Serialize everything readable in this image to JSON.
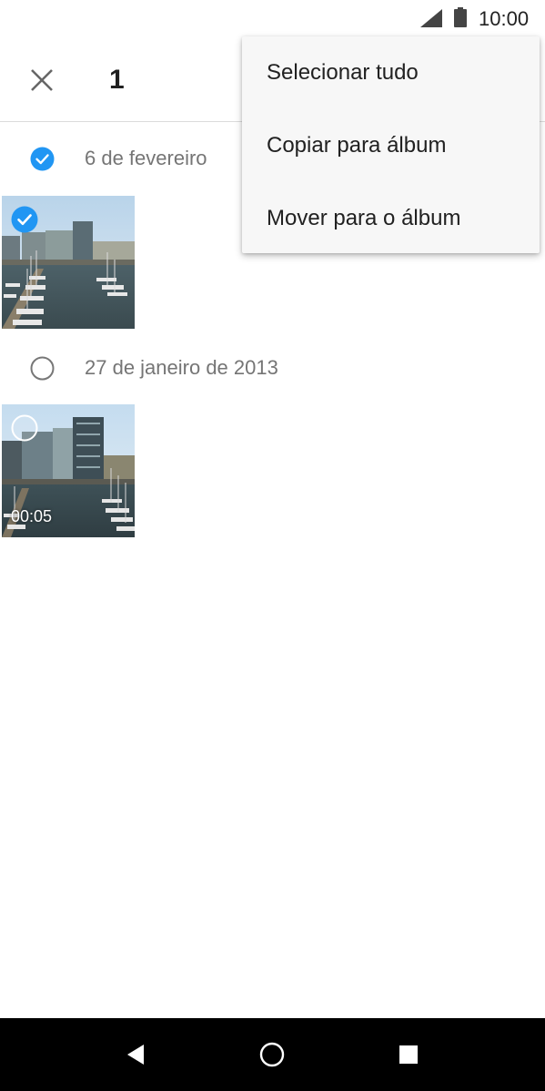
{
  "status_bar": {
    "time": "10:00",
    "signal_icon": "cell-signal-icon",
    "battery_icon": "battery-icon"
  },
  "app_bar": {
    "close_icon": "close-icon",
    "selection_count": "1"
  },
  "groups": [
    {
      "date": "6 de fevereiro",
      "selected": true,
      "items": [
        {
          "type": "photo",
          "selected": true
        }
      ]
    },
    {
      "date": "27 de janeiro de 2013",
      "selected": false,
      "items": [
        {
          "type": "video",
          "selected": false,
          "duration": "00:05"
        }
      ]
    }
  ],
  "menu": {
    "items": [
      {
        "label": "Selecionar tudo"
      },
      {
        "label": "Copiar para álbum"
      },
      {
        "label": "Mover para o álbum"
      }
    ]
  },
  "nav_bar": {
    "back_icon": "back-triangle-icon",
    "home_icon": "home-circle-icon",
    "recents_icon": "recents-square-icon"
  },
  "colors": {
    "accent": "#2196f3",
    "menu_bg": "#f7f7f7",
    "nav_bg": "#000000"
  }
}
